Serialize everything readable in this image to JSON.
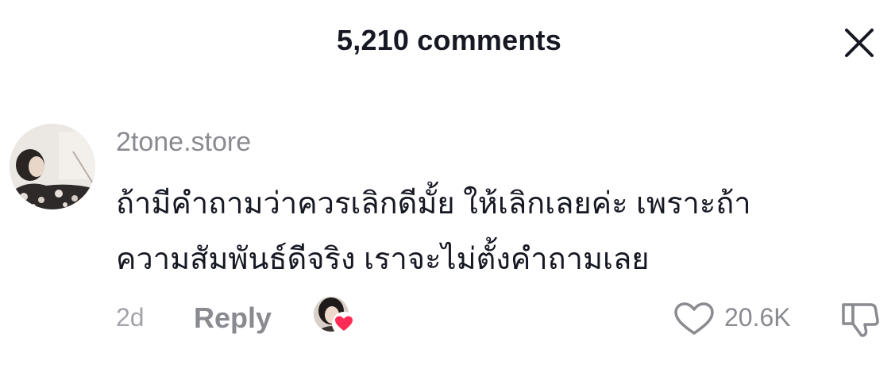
{
  "header": {
    "title": "5,210 comments",
    "close_icon": "close-icon"
  },
  "comment": {
    "username": "2tone.store",
    "text_lines": [
      "ถ้ามีคำถามว่าควรเลิกดีมั้ย ให้เลิกเลยค่ะ เพราะถ้า",
      "ความสัมพันธ์ดีจริง เราจะไม่ตั้งคำถามเลย"
    ],
    "timestamp": "2d",
    "reply_label": "Reply",
    "creator_liked_icon": "creator-heart-icon",
    "like_icon": "heart-outline-icon",
    "like_count": "20.6K",
    "dislike_icon": "thumbs-down-icon"
  },
  "colors": {
    "primary_text": "#161823",
    "secondary_text": "#8a8b91",
    "heart_red": "#fe2c55"
  }
}
